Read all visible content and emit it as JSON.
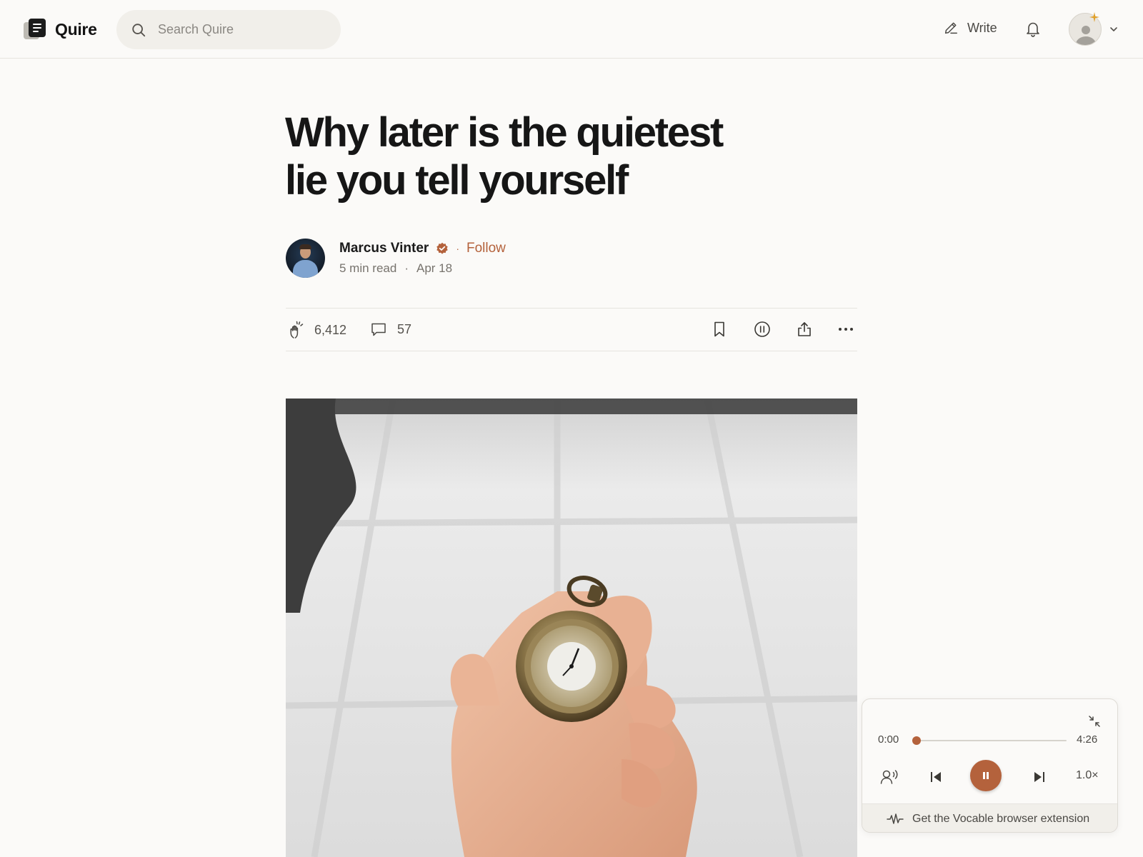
{
  "header": {
    "brand": "Quire",
    "search_placeholder": "Search Quire",
    "write_label": "Write"
  },
  "article": {
    "title": "Why later is the quietest lie you tell yourself",
    "author": "Marcus Vinter",
    "follow_label": "Follow",
    "read_time": "5 min read",
    "date": "Apr 18",
    "claps": "6,412",
    "comments": "57"
  },
  "player": {
    "current_time": "0:00",
    "duration": "4:26",
    "progress": 0.0,
    "speed": "1.0×",
    "promo": "Get the Vocable browser extension"
  },
  "colors": {
    "accent": "#b4623c",
    "background": "#fbfaf8",
    "text": "#1a1a1a",
    "muted": "#77736d"
  }
}
